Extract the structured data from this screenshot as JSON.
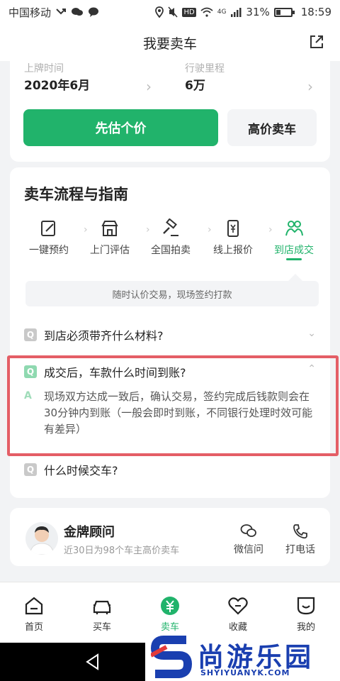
{
  "status_bar": {
    "carrier": "中国移动",
    "battery": "31%",
    "time": "18:59",
    "network": "4G",
    "hd": "HD"
  },
  "header": {
    "title": "我要卖车",
    "share_icon": "share-icon"
  },
  "car_info": {
    "plate_time_label": "上牌时间",
    "plate_time_value": "2020年6月",
    "mileage_label": "行驶里程",
    "mileage_value": "6万",
    "estimate_button": "先估个价",
    "high_price_button": "高价卖车"
  },
  "guide": {
    "title": "卖车流程与指南",
    "steps": [
      {
        "label": "一键预约",
        "icon": "edit-icon"
      },
      {
        "label": "上门评估",
        "icon": "store-icon"
      },
      {
        "label": "全国拍卖",
        "icon": "gavel-icon"
      },
      {
        "label": "线上报价",
        "icon": "yen-phone-icon"
      },
      {
        "label": "到店成交",
        "icon": "handshake-icon"
      }
    ],
    "active_step": 4,
    "tip": "随时认价交易，现场签约打款",
    "faqs": [
      {
        "q": "到店必须带齐什么材料?",
        "expanded": false
      },
      {
        "q": "成交后，车款什么时间到账?",
        "expanded": true,
        "a": "现场双方达成一致后，确认交易，签约完成后钱款则会在30分钟内到账（一般会即时到账，不同银行处理时效可能有差异）"
      },
      {
        "q": "什么时候交车?",
        "expanded": false
      }
    ],
    "q_badge": "Q",
    "a_badge": "A"
  },
  "advisor": {
    "name": "金牌顾问",
    "subtitle": "近30日为98个车主高价卖车",
    "actions": [
      {
        "label": "微信问",
        "icon": "wechat-icon"
      },
      {
        "label": "打电话",
        "icon": "phone-icon"
      }
    ]
  },
  "tabbar": {
    "items": [
      {
        "label": "首页",
        "icon": "home-icon"
      },
      {
        "label": "买车",
        "icon": "car-icon"
      },
      {
        "label": "卖车",
        "icon": "yen-icon"
      },
      {
        "label": "收藏",
        "icon": "heart-icon"
      },
      {
        "label": "我的",
        "icon": "profile-icon"
      }
    ],
    "active": 2
  },
  "watermark": {
    "title": "尚游乐园",
    "subtitle": "SHYIYUANYK.COM"
  },
  "colors": {
    "accent": "#21b36b",
    "highlight": "#e45e66",
    "watermark": "#1a3fb0"
  }
}
